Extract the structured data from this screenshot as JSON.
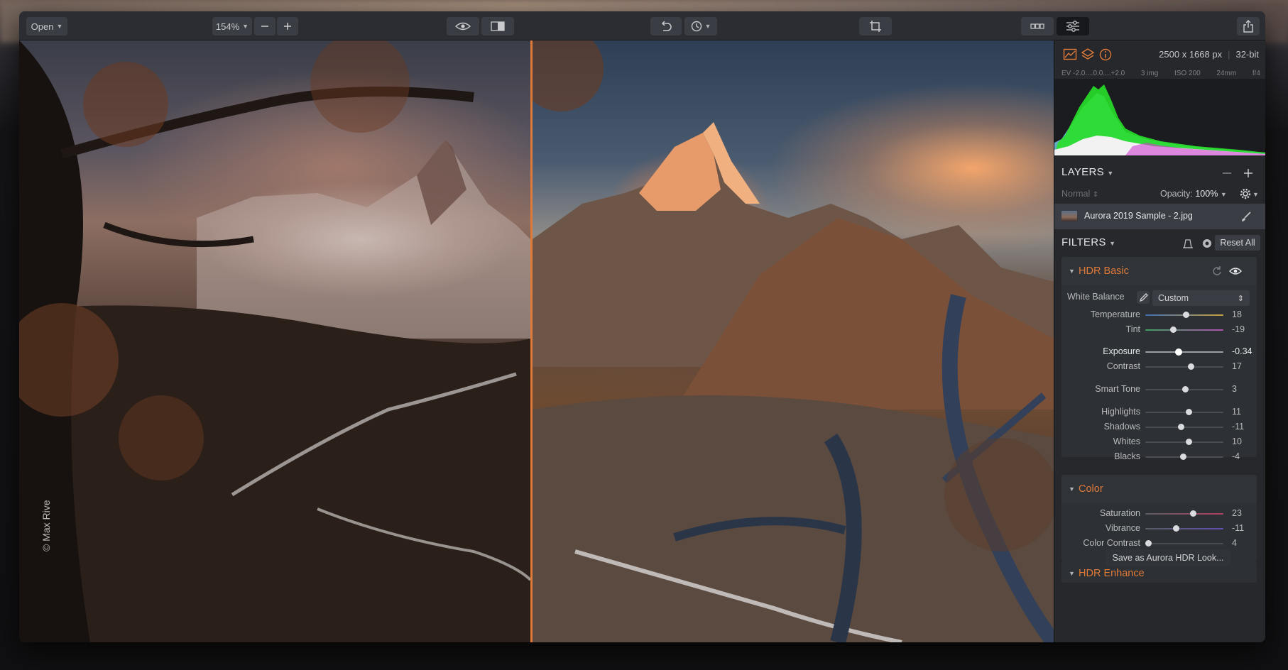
{
  "toolbar": {
    "open_label": "Open",
    "zoom_label": "154%"
  },
  "image": {
    "watermark": "© Max Rive"
  },
  "panel": {
    "meta": {
      "dimensions": "2500 x 1668 px",
      "bit_depth": "32-bit",
      "ev": "EV  -2.0....0.0....+2.0",
      "images": "3 img",
      "iso": "ISO 200",
      "focal": "24mm",
      "aperture": "f/4"
    },
    "layers": {
      "title": "LAYERS",
      "blend_mode": "Normal",
      "opacity_label": "Opacity:",
      "opacity_value": "100%",
      "layer_name": "Aurora 2019 Sample - 2.jpg"
    },
    "filters": {
      "title": "FILTERS",
      "reset_all": "Reset All"
    },
    "hdr_basic": {
      "title": "HDR Basic",
      "white_balance_label": "White Balance",
      "white_balance_value": "Custom",
      "sliders": [
        {
          "label": "Temperature",
          "value": "18",
          "pos": 0.52
        },
        {
          "label": "Tint",
          "value": "-19",
          "pos": 0.35
        },
        {
          "label": "Exposure",
          "value": "-0.34",
          "pos": 0.42
        },
        {
          "label": "Contrast",
          "value": "17",
          "pos": 0.58
        },
        {
          "label": "Smart Tone",
          "value": "3",
          "pos": 0.51
        },
        {
          "label": "Highlights",
          "value": "11",
          "pos": 0.55
        },
        {
          "label": "Shadows",
          "value": "-11",
          "pos": 0.45
        },
        {
          "label": "Whites",
          "value": "10",
          "pos": 0.55
        },
        {
          "label": "Blacks",
          "value": "-4",
          "pos": 0.48
        }
      ]
    },
    "color": {
      "title": "Color",
      "sliders": [
        {
          "label": "Saturation",
          "value": "23",
          "pos": 0.61
        },
        {
          "label": "Vibrance",
          "value": "-11",
          "pos": 0.39
        },
        {
          "label": "Color Contrast",
          "value": "4",
          "pos": 0.04
        }
      ]
    },
    "hdr_enhance": {
      "title": "HDR Enhance"
    },
    "save_look": "Save as Aurora HDR Look..."
  },
  "colors": {
    "accent": "#e07a38",
    "panel_bg": "#26282c",
    "toolbar_bg": "#2b2d32"
  }
}
